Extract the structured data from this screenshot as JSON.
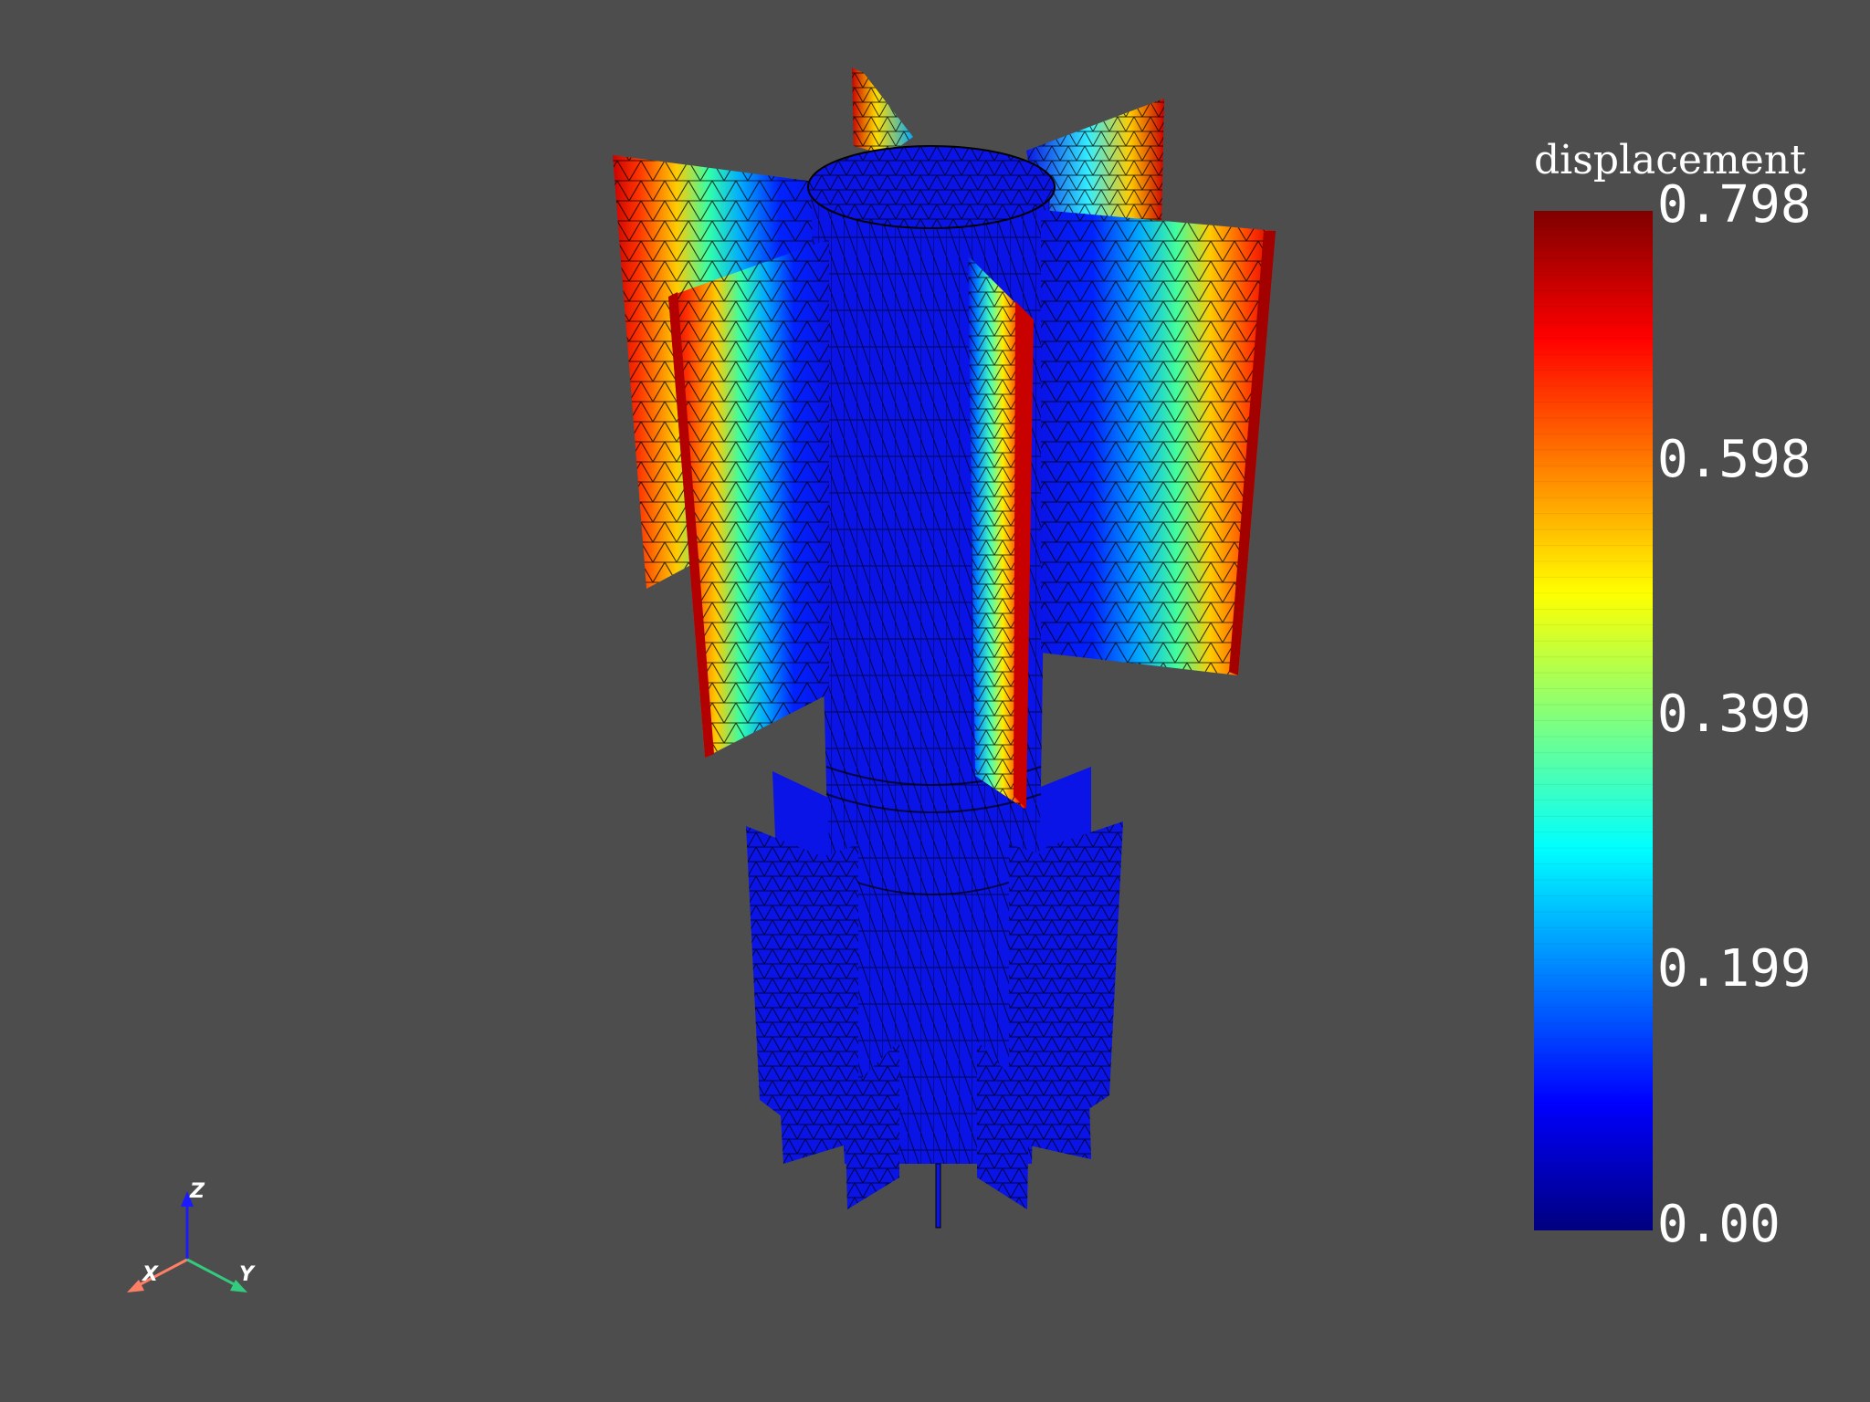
{
  "scalar_bar": {
    "title": "displacement",
    "ticks": [
      "0.798",
      "0.598",
      "0.399",
      "0.199",
      "0.00"
    ],
    "min": 0.0,
    "max": 0.798,
    "colormap": [
      "#00007f",
      "#0000ff",
      "#007fff",
      "#00ffff",
      "#7fff7f",
      "#ffff00",
      "#ff7f00",
      "#ff0000",
      "#7f0000"
    ]
  },
  "orientation_axes": {
    "x_label": "X",
    "y_label": "Y",
    "z_label": "Z",
    "x_color": "#ff7f66",
    "y_color": "#33cc7f",
    "z_color": "#1a1aff"
  },
  "model": {
    "base_color": "#0a14e6",
    "mesh_color": "#000000"
  },
  "background_color": "#4d4d4d"
}
